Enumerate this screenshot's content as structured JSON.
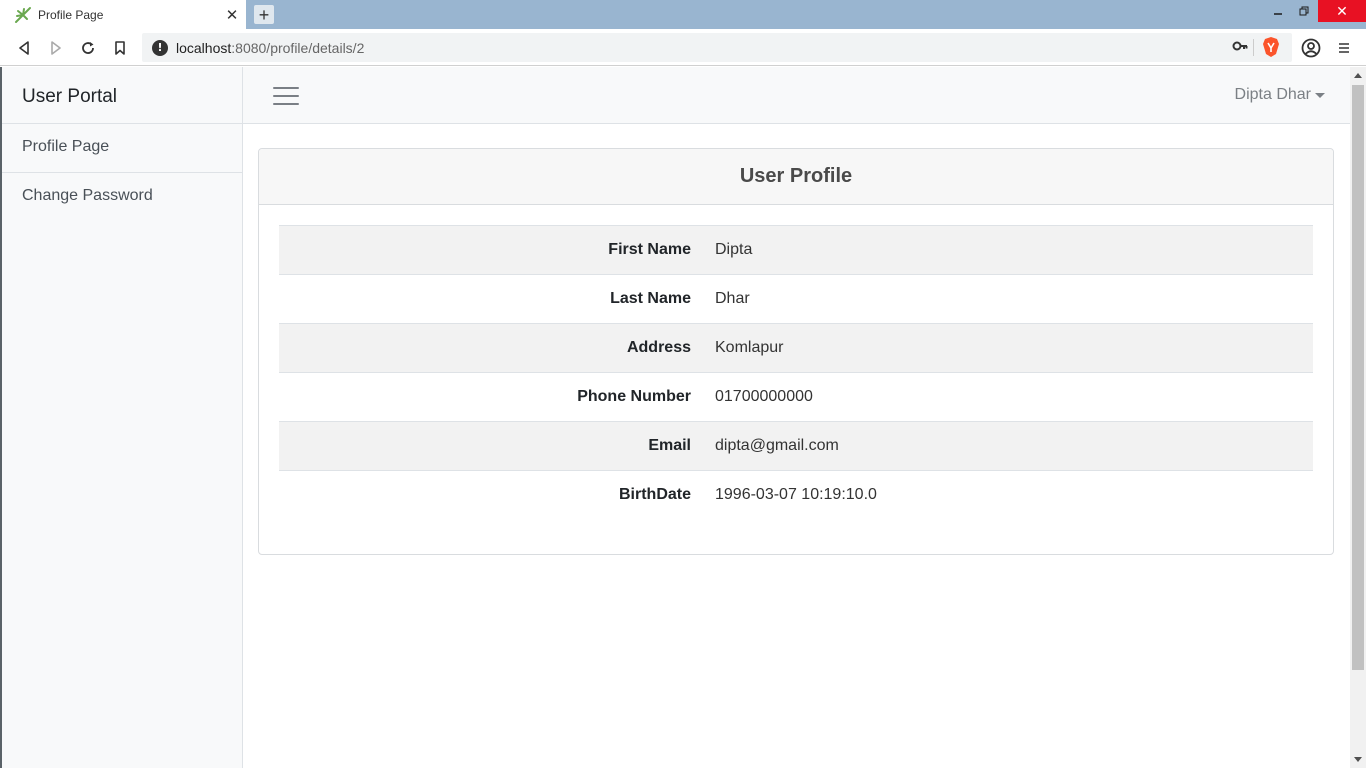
{
  "browser": {
    "tab_title": "Profile Page",
    "tab_close": "✕",
    "new_tab": "+",
    "url_host": "localhost",
    "url_path": ":8080/profile/details/2",
    "window_close": "✕"
  },
  "sidebar": {
    "heading": "User Portal",
    "items": [
      {
        "label": "Profile Page"
      },
      {
        "label": "Change Password"
      }
    ]
  },
  "topnav": {
    "user_name": "Dipta Dhar"
  },
  "profile": {
    "title": "User Profile",
    "rows": [
      {
        "label": "First Name",
        "value": "Dipta"
      },
      {
        "label": "Last Name",
        "value": "Dhar"
      },
      {
        "label": "Address",
        "value": "Komlapur"
      },
      {
        "label": "Phone Number",
        "value": "01700000000"
      },
      {
        "label": "Email",
        "value": "dipta@gmail.com"
      },
      {
        "label": "BirthDate",
        "value": "1996-03-07 10:19:10.0"
      }
    ]
  },
  "colors": {
    "tabbar": "#99b5d0",
    "sidebar_bg": "#f8f9fa",
    "window_close": "#e81123",
    "brave_orange": "#fb542b"
  }
}
